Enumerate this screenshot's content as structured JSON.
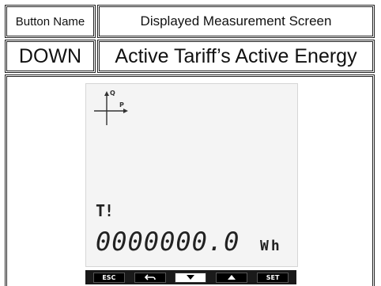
{
  "table": {
    "header_button": "Button Name",
    "header_screen": "Displayed Measurement Screen",
    "button": "DOWN",
    "measurement": "Active Tariff’s Active Energy"
  },
  "lcd": {
    "axis_q": "Q",
    "axis_p": "P",
    "tariff": "T!",
    "value": "0000000.0",
    "unit": "Wh"
  },
  "keys": {
    "esc": "ESC",
    "set": "SET"
  },
  "icons": [
    "back-arrow-icon",
    "down-arrow-icon",
    "up-arrow-icon"
  ]
}
